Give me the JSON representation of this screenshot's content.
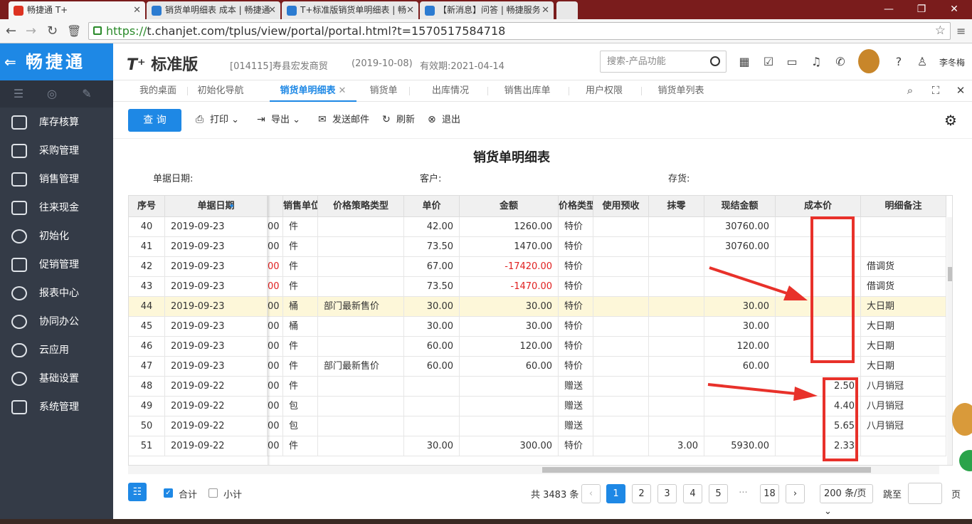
{
  "browser": {
    "tabs": [
      {
        "title": "畅捷通 T+",
        "active": true
      },
      {
        "title": "销货单明细表 成本 | 畅捷通",
        "active": false
      },
      {
        "title": "T+标准版销货单明细表 | 畅",
        "active": false
      },
      {
        "title": "【新消息】问答 | 畅捷服务",
        "active": false
      }
    ],
    "url_scheme": "https://",
    "url_rest": "t.chanjet.com/tplus/view/portal/portal.html?t=1570517584718",
    "min": "—",
    "max": "❐",
    "close": "✕"
  },
  "header": {
    "logo_text": "畅捷通",
    "back_glyph": "⇐",
    "brand_tplus": "T⁺",
    "brand_edition": "标准版",
    "company": "[014115]寿县宏发商贸",
    "date": "(2019-10-08)",
    "validity": "有效期:2021-04-14",
    "search_placeholder": "搜索-产品功能",
    "username": "李冬梅"
  },
  "sidebar": {
    "items": [
      {
        "label": "库存核算"
      },
      {
        "label": "采购管理"
      },
      {
        "label": "销售管理"
      },
      {
        "label": "往来现金"
      },
      {
        "label": "初始化"
      },
      {
        "label": "促销管理"
      },
      {
        "label": "报表中心"
      },
      {
        "label": "协同办公"
      },
      {
        "label": "云应用"
      },
      {
        "label": "基础设置"
      },
      {
        "label": "系统管理"
      }
    ]
  },
  "page_tabs": [
    {
      "label": "我的桌面",
      "active": false
    },
    {
      "label": "初始化导航",
      "active": false
    },
    {
      "label": "销货单明细表",
      "active": true
    },
    {
      "label": "销货单",
      "active": false
    },
    {
      "label": "出库情况",
      "active": false
    },
    {
      "label": "销售出库单",
      "active": false
    },
    {
      "label": "用户权限",
      "active": false
    },
    {
      "label": "销货单列表",
      "active": false
    }
  ],
  "toolbar": {
    "query": "查 询",
    "print": "打印",
    "export": "导出",
    "email": "发送邮件",
    "refresh": "刷新",
    "exit": "退出"
  },
  "report": {
    "title": "销货单明细表",
    "filter_date": "单据日期:",
    "filter_customer": "客户:",
    "filter_inventory": "存货:"
  },
  "table": {
    "columns": [
      "序号",
      "单据日期",
      "",
      "销售单位",
      "价格策略类型",
      "单价",
      "金额",
      "价格类型",
      "使用预收",
      "抹零",
      "现结金额",
      "成本价",
      "明细备注"
    ],
    "rows": [
      {
        "no": "40",
        "date": "2019-09-23",
        "qty": "00",
        "unit": "件",
        "strategy": "",
        "price": "42.00",
        "amount": "1260.00",
        "ptype": "特价",
        "prepay": "",
        "round": "",
        "cash": "30760.00",
        "cost": "",
        "note": "",
        "hl": false,
        "neg": false,
        "qneg": false
      },
      {
        "no": "41",
        "date": "2019-09-23",
        "qty": "00",
        "unit": "件",
        "strategy": "",
        "price": "73.50",
        "amount": "1470.00",
        "ptype": "特价",
        "prepay": "",
        "round": "",
        "cash": "30760.00",
        "cost": "",
        "note": "",
        "hl": false,
        "neg": false,
        "qneg": false
      },
      {
        "no": "42",
        "date": "2019-09-23",
        "qty": "00",
        "unit": "件",
        "strategy": "",
        "price": "67.00",
        "amount": "-17420.00",
        "ptype": "特价",
        "prepay": "",
        "round": "",
        "cash": "",
        "cost": "",
        "note": "借调货",
        "hl": false,
        "neg": true,
        "qneg": true
      },
      {
        "no": "43",
        "date": "2019-09-23",
        "qty": "00",
        "unit": "件",
        "strategy": "",
        "price": "73.50",
        "amount": "-1470.00",
        "ptype": "特价",
        "prepay": "",
        "round": "",
        "cash": "",
        "cost": "",
        "note": "借调货",
        "hl": false,
        "neg": true,
        "qneg": true
      },
      {
        "no": "44",
        "date": "2019-09-23",
        "qty": "00",
        "unit": "桶",
        "strategy": "部门最新售价",
        "price": "30.00",
        "amount": "30.00",
        "ptype": "特价",
        "prepay": "",
        "round": "",
        "cash": "30.00",
        "cost": "",
        "note": "大日期",
        "hl": true,
        "neg": false,
        "qneg": false
      },
      {
        "no": "45",
        "date": "2019-09-23",
        "qty": "00",
        "unit": "桶",
        "strategy": "",
        "price": "30.00",
        "amount": "30.00",
        "ptype": "特价",
        "prepay": "",
        "round": "",
        "cash": "30.00",
        "cost": "",
        "note": "大日期",
        "hl": false,
        "neg": false,
        "qneg": false
      },
      {
        "no": "46",
        "date": "2019-09-23",
        "qty": "00",
        "unit": "件",
        "strategy": "",
        "price": "60.00",
        "amount": "120.00",
        "ptype": "特价",
        "prepay": "",
        "round": "",
        "cash": "120.00",
        "cost": "",
        "note": "大日期",
        "hl": false,
        "neg": false,
        "qneg": false
      },
      {
        "no": "47",
        "date": "2019-09-23",
        "qty": "00",
        "unit": "件",
        "strategy": "部门最新售价",
        "price": "60.00",
        "amount": "60.00",
        "ptype": "特价",
        "prepay": "",
        "round": "",
        "cash": "60.00",
        "cost": "",
        "note": "大日期",
        "hl": false,
        "neg": false,
        "qneg": false
      },
      {
        "no": "48",
        "date": "2019-09-22",
        "qty": "00",
        "unit": "件",
        "strategy": "",
        "price": "",
        "amount": "",
        "ptype": "赠送",
        "prepay": "",
        "round": "",
        "cash": "",
        "cost": "2.50",
        "note": "八月销冠",
        "hl": false,
        "neg": false,
        "qneg": false
      },
      {
        "no": "49",
        "date": "2019-09-22",
        "qty": "00",
        "unit": "包",
        "strategy": "",
        "price": "",
        "amount": "",
        "ptype": "赠送",
        "prepay": "",
        "round": "",
        "cash": "",
        "cost": "4.40",
        "note": "八月销冠",
        "hl": false,
        "neg": false,
        "qneg": false
      },
      {
        "no": "50",
        "date": "2019-09-22",
        "qty": "00",
        "unit": "包",
        "strategy": "",
        "price": "",
        "amount": "",
        "ptype": "赠送",
        "prepay": "",
        "round": "",
        "cash": "",
        "cost": "5.65",
        "note": "八月销冠",
        "hl": false,
        "neg": false,
        "qneg": false
      },
      {
        "no": "51",
        "date": "2019-09-22",
        "qty": "00",
        "unit": "件",
        "strategy": "",
        "price": "30.00",
        "amount": "300.00",
        "ptype": "特价",
        "prepay": "",
        "round": "3.00",
        "cash": "5930.00",
        "cost": "2.33",
        "note": "",
        "hl": false,
        "neg": false,
        "qneg": false
      }
    ]
  },
  "footer": {
    "total_label": "合计",
    "subtotal_label": "小计",
    "record_count": "共 3483 条",
    "pages": [
      "1",
      "2",
      "3",
      "4",
      "5",
      "···",
      "18"
    ],
    "prev": "‹",
    "next": "›",
    "page_size": "200 条/页",
    "jump_label": "跳至",
    "page_suffix": "页"
  },
  "colors": {
    "accent": "#1e88e5",
    "sidebar": "#343b47",
    "annotation": "#e8312a",
    "negative": "#e02020",
    "highlight_row": "#fdf7d9"
  }
}
